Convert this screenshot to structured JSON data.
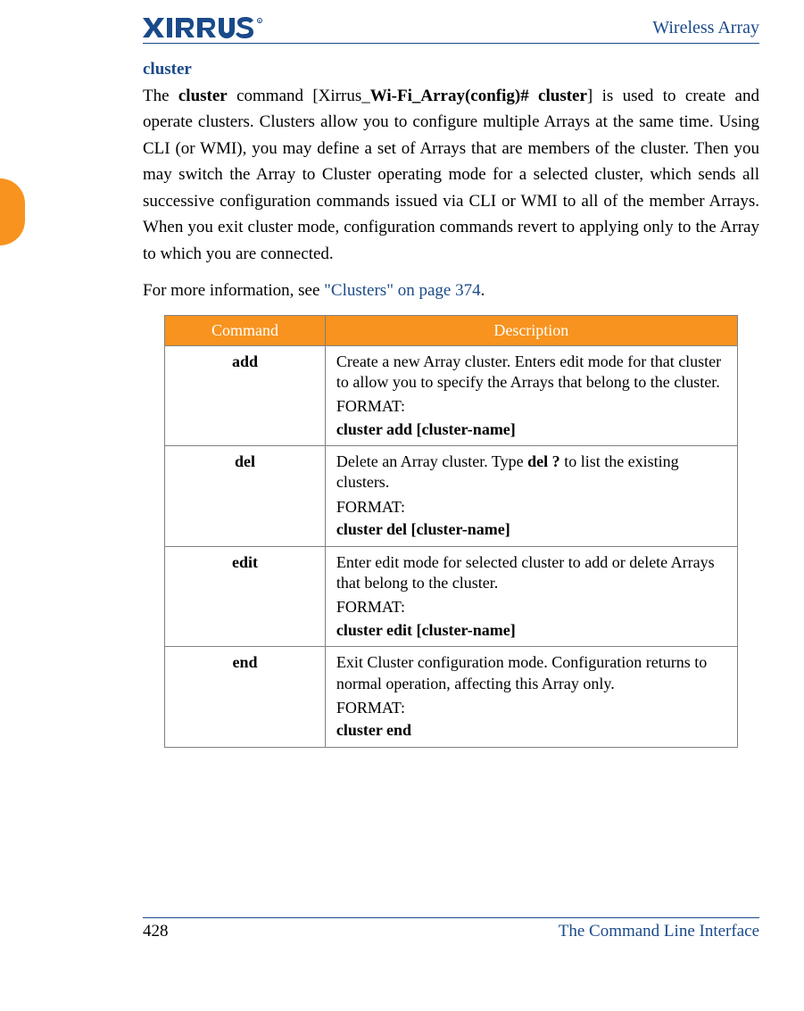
{
  "header": {
    "doc_title": "Wireless Array"
  },
  "section": {
    "title": "cluster",
    "para1_prefix": "The ",
    "para1_bold1": "cluster",
    "para1_mid1": " command [Xirrus_",
    "para1_bold2": "Wi-Fi_Array(config)# cluster",
    "para1_mid2": "] is used to create and operate clusters. Clusters allow you to configure multiple Arrays at the same time. Using CLI (or WMI), you may define a set of Arrays that are members of the cluster. Then you may switch the Array to Cluster operating mode for a selected cluster, which sends all successive configuration commands issued via CLI or WMI to all of the member Arrays. When you exit cluster mode, configuration commands revert to applying only to the Array to which you are connected.",
    "para2_prefix": "For more information, see ",
    "para2_link": "\"Clusters\" on page 374",
    "para2_suffix": "."
  },
  "table": {
    "head_cmd": "Command",
    "head_desc": "Description",
    "rows": [
      {
        "cmd": "add",
        "desc": "Create a new Array cluster. Enters edit mode for that cluster to allow you to specify the Arrays that belong to the cluster.",
        "format_label": "FORMAT:",
        "format_cmd": "cluster add [cluster-name]"
      },
      {
        "cmd": "del",
        "desc_pre": "Delete an Array cluster. Type ",
        "desc_bold": "del ?",
        "desc_post": " to list the existing clusters.",
        "format_label": "FORMAT:",
        "format_cmd": "cluster del [cluster-name]"
      },
      {
        "cmd": "edit",
        "desc": "Enter edit mode for selected cluster to add or delete Arrays that belong to the cluster.",
        "format_label": "FORMAT:",
        "format_cmd": "cluster edit [cluster-name]"
      },
      {
        "cmd": "end",
        "desc": "Exit Cluster configuration mode. Configuration returns to normal operation, affecting this Array only.",
        "format_label": "FORMAT:",
        "format_cmd": "cluster end"
      }
    ]
  },
  "footer": {
    "page": "428",
    "title": "The Command Line Interface"
  }
}
